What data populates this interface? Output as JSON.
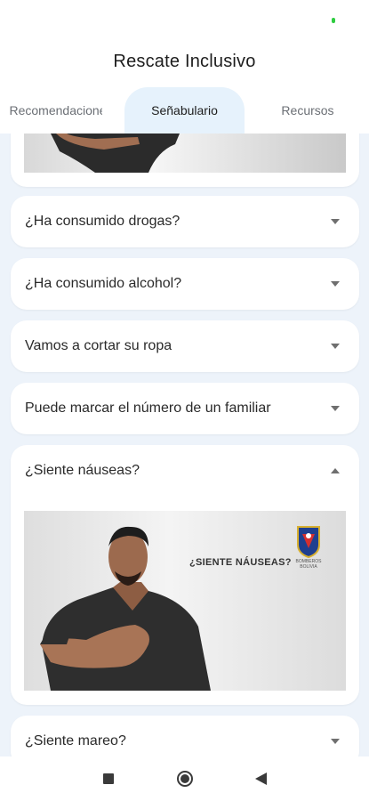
{
  "app": {
    "title": "Rescate Inclusivo"
  },
  "tabs": [
    {
      "label": "Recomendaciones"
    },
    {
      "label": "Señabulario"
    },
    {
      "label": "Recursos"
    }
  ],
  "items": [
    {
      "label": "¿Ha consumido drogas?",
      "expanded": false
    },
    {
      "label": "¿Ha consumido alcohol?",
      "expanded": false
    },
    {
      "label": "Vamos a cortar su ropa",
      "expanded": false
    },
    {
      "label": "Puede marcar el número de un familiar",
      "expanded": false
    },
    {
      "label": "¿Siente náuseas?",
      "expanded": true,
      "video_caption": "¿SIENTE NÁUSEAS?",
      "video_badge_text": "BOMBEROS BOLIVIA"
    },
    {
      "label": "¿Siente mareo?",
      "expanded": false
    }
  ],
  "icons": {
    "expand": "chevron-down-icon",
    "collapse": "chevron-up-icon",
    "nav_recent": "square-icon",
    "nav_home": "circle-icon",
    "nav_back": "triangle-back-icon"
  },
  "colors": {
    "active_tab_bg": "#e6f2fc",
    "content_bg": "#edf3fa",
    "status_dot": "#2ecc40"
  }
}
